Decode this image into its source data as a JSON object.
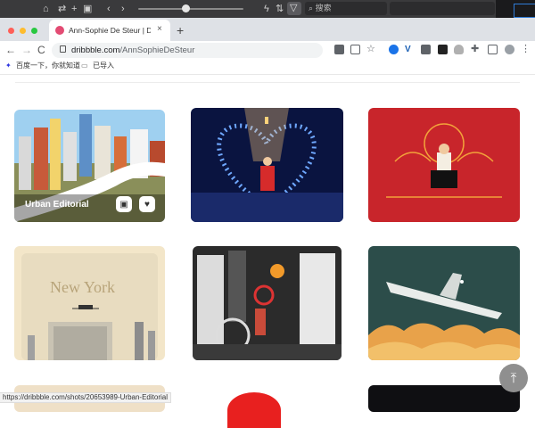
{
  "os_bar": {
    "search_placeholder": "搜索",
    "icons": [
      "home-icon",
      "swap-icon",
      "add-icon",
      "sidebar-icon",
      "back-icon",
      "forward-icon",
      "lightning-icon",
      "sort-icon",
      "filter-icon",
      "search-icon"
    ]
  },
  "browser": {
    "tab_title": "Ann-Sophie De Steur | Dribbble",
    "new_tab": "+",
    "address_host": "dribbble.com",
    "address_path": "/AnnSophieDeSteur",
    "close_tab": "×",
    "nav": {
      "back": "←",
      "forward": "→",
      "reload": "C"
    }
  },
  "bookmarks": [
    {
      "label": "百度一下，你就知道"
    },
    {
      "label": "已导入"
    }
  ],
  "shots": [
    {
      "title": "Urban Editorial",
      "accent": "#f2c94c"
    },
    {
      "title": "",
      "accent": "#0a1440"
    },
    {
      "title": "",
      "accent": "#c8252b"
    },
    {
      "title": "",
      "accent": "#f3e6c9",
      "text": "New York"
    },
    {
      "title": "",
      "accent": "#2b2b2b"
    },
    {
      "title": "",
      "accent": "#2c4d4a"
    }
  ],
  "status_url": "https://dribbble.com/shots/20653989-Urban-Editorial",
  "colors": {
    "brand": "#ea4c89",
    "chrome_tab": "#dee1e6"
  }
}
